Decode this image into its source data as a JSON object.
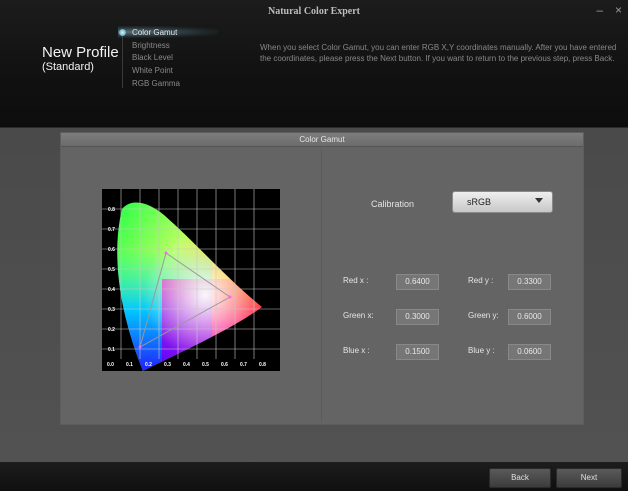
{
  "window": {
    "title": "Natural Color Expert",
    "minimize_glyph": "–",
    "close_glyph": "×"
  },
  "profile": {
    "title": "New Profile",
    "subtitle": "(Standard)"
  },
  "steps": [
    {
      "label": "Color Gamut",
      "active": true
    },
    {
      "label": "Brightness",
      "active": false
    },
    {
      "label": "Black Level",
      "active": false
    },
    {
      "label": "White Point",
      "active": false
    },
    {
      "label": "RGB Gamma",
      "active": false
    }
  ],
  "instructions": "When you select Color Gamut, you can enter RGB X,Y coordinates manually. After you have entered the coordinates, please press the Next button. If you want to return to the previous step, press Back.",
  "panel": {
    "title": "Color Gamut",
    "chart": {
      "x_ticks": [
        "0.0",
        "0.1",
        "0.2",
        "0.3",
        "0.4",
        "0.5",
        "0.6",
        "0.7",
        "0.8"
      ],
      "y_ticks": [
        "0.8",
        "0.7",
        "0.6",
        "0.5",
        "0.4",
        "0.3",
        "0.2",
        "0.1"
      ]
    },
    "calibration": {
      "label": "Calibration",
      "value": "sRGB",
      "icon": "dropdown-arrow-icon"
    },
    "coords": {
      "red_x_label": "Red x :",
      "red_x": "0.6400",
      "red_y_label": "Red y :",
      "red_y": "0.3300",
      "green_x_label": "Green x:",
      "green_x": "0.3000",
      "green_y_label": "Green y:",
      "green_y": "0.6000",
      "blue_x_label": "Blue x :",
      "blue_x": "0.1500",
      "blue_y_label": "Blue y :",
      "blue_y": "0.0600"
    }
  },
  "footer": {
    "back_label": "Back",
    "next_label": "Next"
  },
  "colors": {
    "header_bg": "#111111",
    "panel_bg": "#646464",
    "accent_glow": "#9fd6e6"
  }
}
